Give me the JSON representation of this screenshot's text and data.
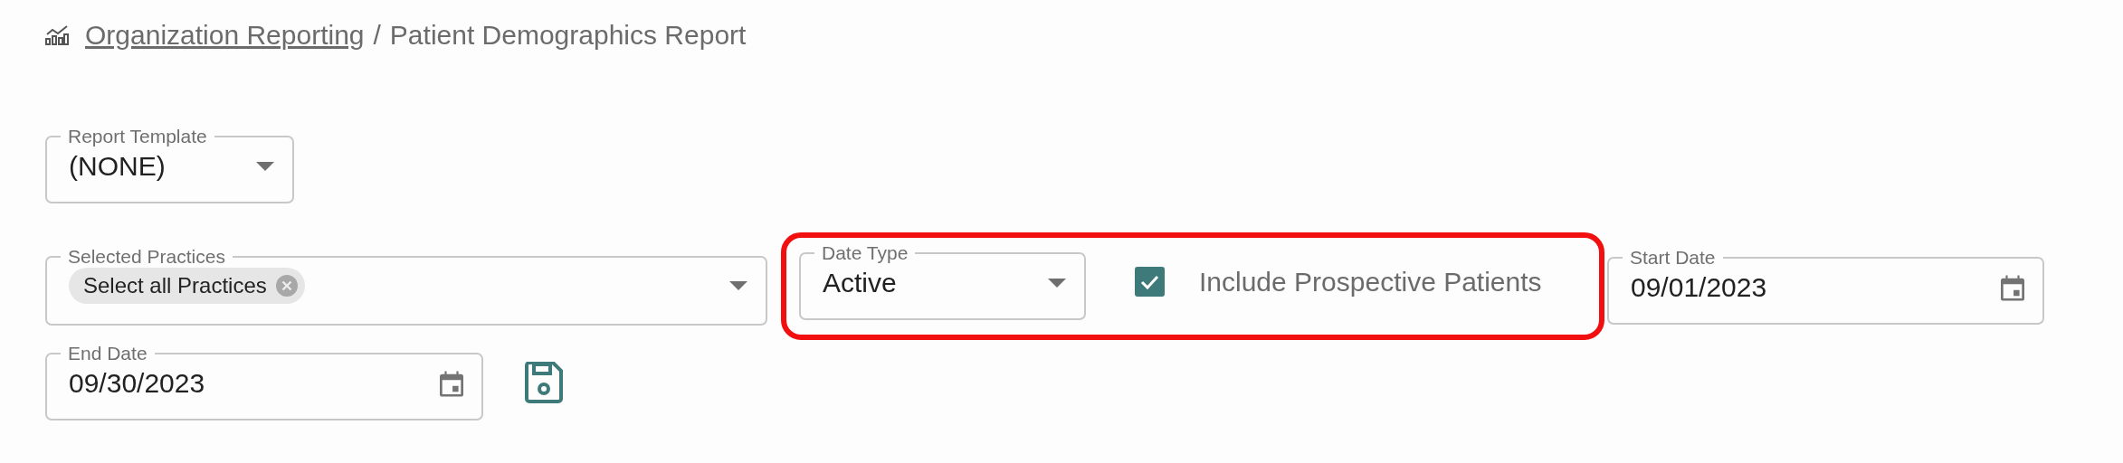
{
  "breadcrumb": {
    "link": "Organization Reporting",
    "separator": "/",
    "current": "Patient Demographics Report"
  },
  "report_template": {
    "label": "Report Template",
    "value": "(NONE)"
  },
  "selected_practices": {
    "label": "Selected Practices",
    "chips": [
      {
        "label": "Select all Practices"
      }
    ]
  },
  "date_type": {
    "label": "Date Type",
    "value": "Active"
  },
  "include_prospective": {
    "label": "Include Prospective Patients",
    "checked": true
  },
  "start_date": {
    "label": "Start Date",
    "value": "09/01/2023"
  },
  "end_date": {
    "label": "End Date",
    "value": "09/30/2023"
  }
}
